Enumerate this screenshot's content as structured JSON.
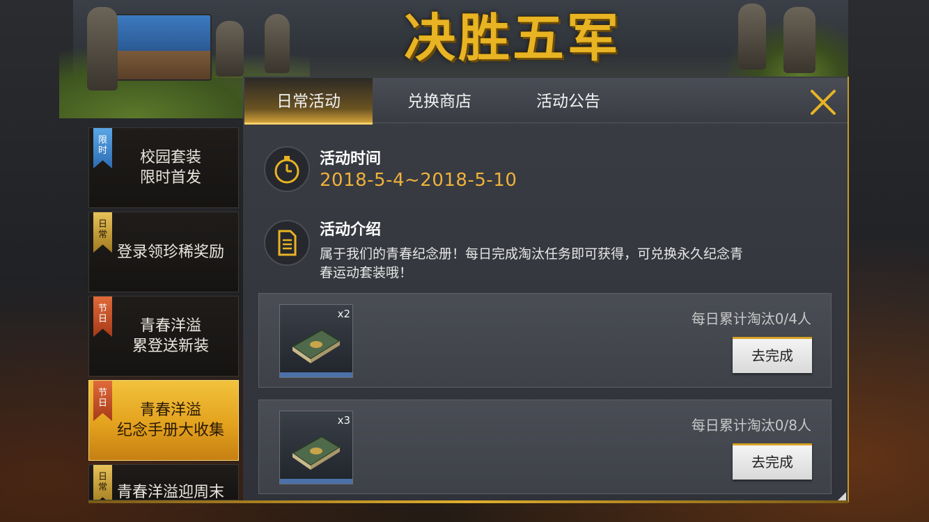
{
  "banner": {
    "title": "决胜五军"
  },
  "tabs": [
    {
      "label": "日常活动"
    },
    {
      "label": "兑换商店"
    },
    {
      "label": "活动公告"
    }
  ],
  "sidebar": {
    "items": [
      {
        "tag": "限时",
        "line1": "校园套装",
        "line2": "限时首发",
        "ribbon": "blue"
      },
      {
        "tag": "日常",
        "line1": "登录领珍稀奖励",
        "line2": "",
        "ribbon": "gold"
      },
      {
        "tag": "节日",
        "line1": "青春洋溢",
        "line2": "累登送新装",
        "ribbon": "red"
      },
      {
        "tag": "节日",
        "line1": "青春洋溢",
        "line2": "纪念手册大收集",
        "ribbon": "red",
        "active": true
      },
      {
        "tag": "日常",
        "line1": "青春洋溢迎周末",
        "line2": "",
        "ribbon": "gold"
      }
    ]
  },
  "activity": {
    "time_heading": "活动时间",
    "time_value": "2018-5-4~2018-5-10",
    "intro_heading": "活动介绍",
    "intro_line1": "属于我们的青春纪念册！每日完成淘汰任务即可获得，可兑换永久纪念青",
    "intro_line2": "春运动套装哦！"
  },
  "tasks": [
    {
      "count": "x2",
      "description": "每日累计淘汰0/4人",
      "button": "去完成"
    },
    {
      "count": "x3",
      "description": "每日累计淘汰0/8人",
      "button": "去完成"
    }
  ],
  "colors": {
    "accent": "#e8b423",
    "date": "#f0b23a",
    "close": "#e8b423"
  },
  "icons": {
    "time": "stopwatch-icon",
    "intro": "document-icon",
    "close": "close-icon",
    "item": "notebook-icon"
  }
}
